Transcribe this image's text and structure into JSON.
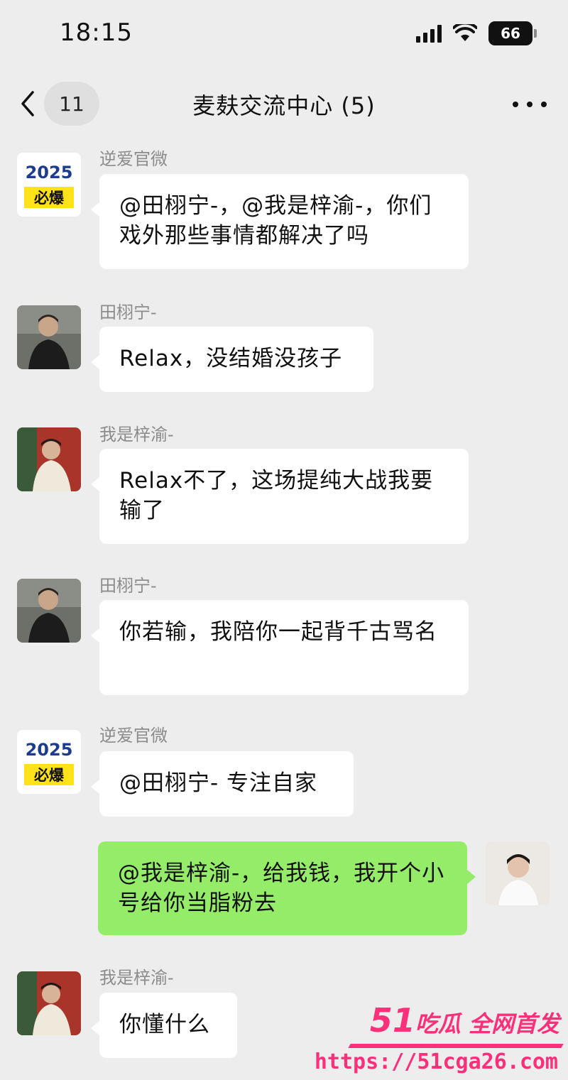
{
  "status_bar": {
    "time": "18:15",
    "battery": "66",
    "wifi_icon": "wifi-icon",
    "signal_icon": "signal-bars-icon"
  },
  "nav": {
    "back_icon": "chevron-left-icon",
    "unread_count": "11",
    "title": "麦麸交流中心 (5)",
    "more_icon": "more-dots-icon"
  },
  "messages": [
    {
      "sender": "逆爱官微",
      "text": "@田栩宁-，@我是梓渝-，你们戏外那些事情都解决了吗",
      "direction": "incoming",
      "avatar": "logo-2025-avatar"
    },
    {
      "sender": "田栩宁-",
      "text": "Relax，没结婚没孩子",
      "direction": "incoming",
      "avatar": "photo-avatar"
    },
    {
      "sender": "我是梓渝-",
      "text": "Relax不了，这场提纯大战我要输了",
      "direction": "incoming",
      "avatar": "photo-avatar"
    },
    {
      "sender": "田栩宁-",
      "text": "你若输，我陪你一起背千古骂名",
      "direction": "incoming",
      "avatar": "photo-avatar"
    },
    {
      "sender": "逆爱官微",
      "text": "@田栩宁- 专注自家",
      "direction": "incoming",
      "avatar": "logo-2025-avatar"
    },
    {
      "sender": "",
      "text": "@我是梓渝-，给我钱，我开个小号给你当脂粉去",
      "direction": "outgoing",
      "avatar": "photo-avatar"
    },
    {
      "sender": "我是梓渝-",
      "text": "你懂什么",
      "direction": "incoming",
      "avatar": "photo-avatar"
    }
  ],
  "logo_avatar": {
    "year": "2025",
    "tag": "必爆"
  },
  "watermark": {
    "brand_num": "51",
    "brand_text": "吃瓜 全网首发",
    "url": "https://51cga26.com"
  },
  "colors": {
    "background": "#ededed",
    "incoming_bubble": "#ffffff",
    "outgoing_bubble": "#95ec69",
    "watermark": "#ff2f7a"
  }
}
